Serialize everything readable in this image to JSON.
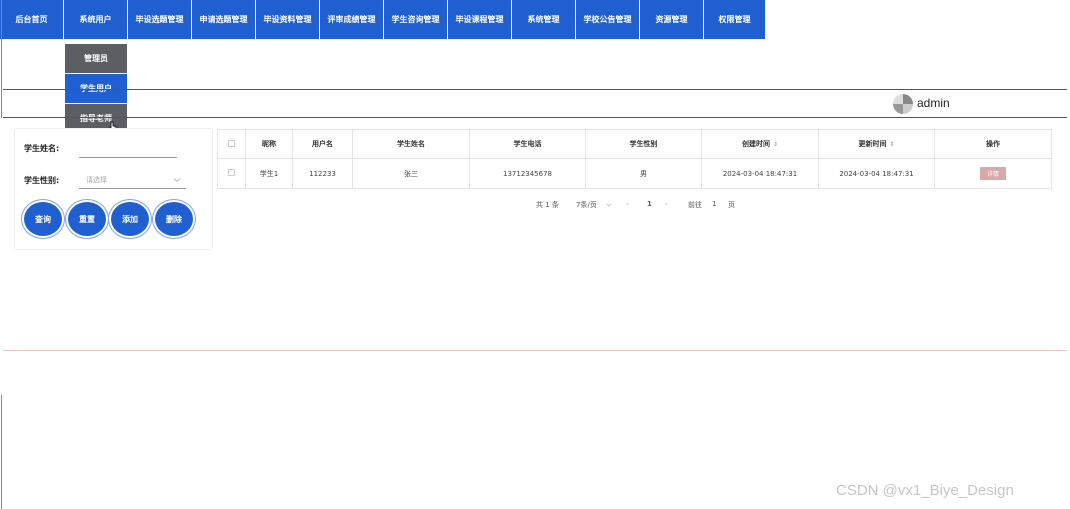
{
  "nav": {
    "items": [
      "后台首页",
      "系统用户",
      "毕设选题管理",
      "申请选题管理",
      "毕设资料管理",
      "评审成绩管理",
      "学生咨询管理",
      "毕设课程管理",
      "系统管理",
      "学校公告管理",
      "资源管理",
      "权限管理"
    ]
  },
  "dropdown": {
    "items": [
      "管理员",
      "学生用户",
      "指导老师"
    ],
    "active": "学生用户"
  },
  "header": {
    "username": "admin"
  },
  "search": {
    "name_label": "学生姓名:",
    "name_value": "",
    "gender_label": "学生性别:",
    "gender_placeholder": "请选择",
    "buttons": {
      "query": "查询",
      "reset": "重置",
      "add": "添加",
      "delete": "删除"
    }
  },
  "table": {
    "headers": [
      "昵称",
      "用户名",
      "学生姓名",
      "学生电话",
      "学生性别",
      "创建时间",
      "更新时间",
      "操作"
    ],
    "rows": [
      {
        "nickname": "学生1",
        "username": "112233",
        "name": "张三",
        "phone": "13712345678",
        "gender": "男",
        "created": "2024-03-04 18:47:31",
        "updated": "2024-03-04 18:47:31",
        "action": "详情"
      }
    ]
  },
  "pagination": {
    "total": "共 1 条",
    "page_size": "7条/页",
    "current_page": "1",
    "goto_label": "前往",
    "goto_value": "1",
    "page_suffix": "页"
  },
  "watermark": "CSDN @vx1_Biye_Design",
  "colors": {
    "primary": "#1f5fd0",
    "dropdown": "#5b5e63",
    "detail": "#d9a8a8"
  }
}
